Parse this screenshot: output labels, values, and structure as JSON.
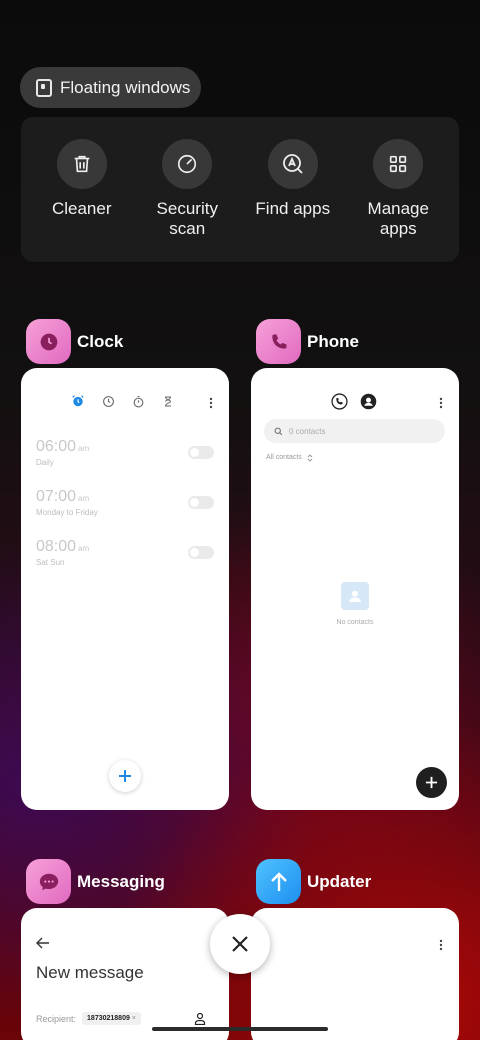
{
  "floating_windows": {
    "label": "Floating windows"
  },
  "tools": [
    {
      "label": "Cleaner",
      "icon": "trash-icon"
    },
    {
      "label": "Security\nscan",
      "icon": "gauge-icon"
    },
    {
      "label": "Find apps",
      "icon": "app-search-icon"
    },
    {
      "label": "Manage\napps",
      "icon": "grid-icon"
    }
  ],
  "apps": {
    "clock": {
      "name": "Clock",
      "alarms": [
        {
          "time": "06:00",
          "ampm": "am",
          "repeat": "Daily"
        },
        {
          "time": "07:00",
          "ampm": "am",
          "repeat": "Monday to Friday"
        },
        {
          "time": "08:00",
          "ampm": "am",
          "repeat": "Sat Sun"
        }
      ]
    },
    "phone": {
      "name": "Phone",
      "search_placeholder": "0 contacts",
      "filter_label": "All contacts",
      "empty_text": "No contacts"
    },
    "messaging": {
      "name": "Messaging",
      "title": "New message",
      "recipient_label": "Recipient:",
      "recipient_chip": "18730218809"
    },
    "updater": {
      "name": "Updater"
    }
  },
  "colors": {
    "clock_accent": "#1e88e5",
    "app_icon_pink": "#e06ac0",
    "app_icon_blue": "#1e8ff0"
  }
}
